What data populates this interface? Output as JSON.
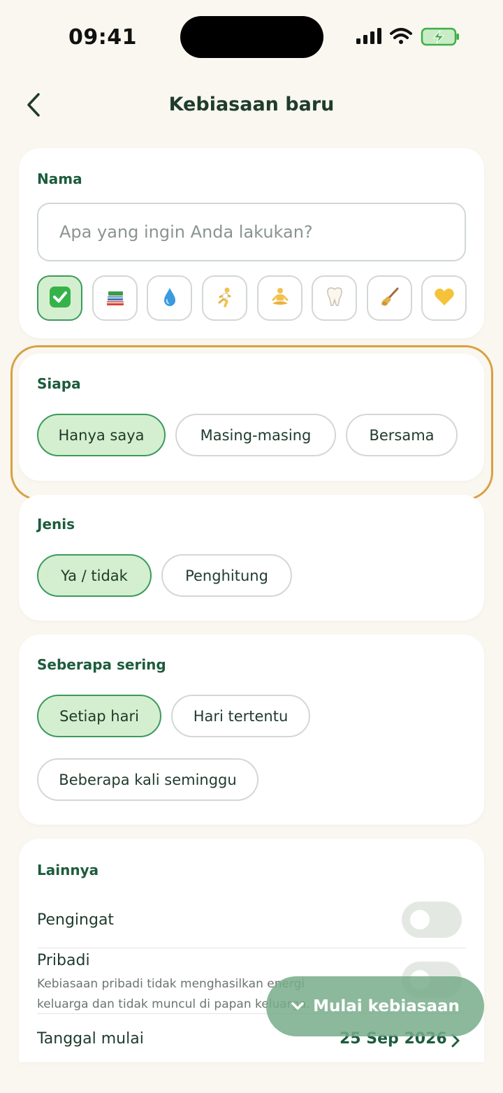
{
  "status_bar": {
    "time": "09:41"
  },
  "header": {
    "title": "Kebiasaan baru",
    "back_icon": "chevron-left-icon"
  },
  "name_section": {
    "label": "Nama",
    "placeholder": "Apa yang ingin Anda lakukan?",
    "value": "",
    "icons": [
      {
        "name": "checkmark-icon",
        "glyph": "✅",
        "selected": true
      },
      {
        "name": "books-icon",
        "glyph": "📚",
        "selected": false
      },
      {
        "name": "droplet-icon",
        "glyph": "💧",
        "selected": false
      },
      {
        "name": "runner-icon",
        "glyph": "🏃",
        "selected": false
      },
      {
        "name": "meditation-icon",
        "glyph": "🧘",
        "selected": false
      },
      {
        "name": "tooth-icon",
        "glyph": "🦷",
        "selected": false
      },
      {
        "name": "broom-icon",
        "glyph": "🧹",
        "selected": false
      },
      {
        "name": "heart-icon",
        "glyph": "💛",
        "selected": false
      }
    ]
  },
  "who_section": {
    "label": "Siapa",
    "options": [
      {
        "label": "Hanya saya",
        "selected": true
      },
      {
        "label": "Masing-masing",
        "selected": false
      },
      {
        "label": "Bersama",
        "selected": false
      }
    ]
  },
  "type_section": {
    "label": "Jenis",
    "options": [
      {
        "label": "Ya / tidak",
        "selected": true
      },
      {
        "label": "Penghitung",
        "selected": false
      }
    ]
  },
  "frequency_section": {
    "label": "Seberapa sering",
    "options": [
      {
        "label": "Setiap hari",
        "selected": true
      },
      {
        "label": "Hari tertentu",
        "selected": false
      },
      {
        "label": "Beberapa kali seminggu",
        "selected": false
      }
    ]
  },
  "other_section": {
    "label": "Lainnya",
    "reminder": {
      "label": "Pengingat",
      "on": false
    },
    "private": {
      "label": "Pribadi",
      "description": "Kebiasaan pribadi tidak menghasilkan energi keluarga dan tidak muncul di papan keluarga.",
      "on": false
    },
    "start_date": {
      "label": "Tanggal mulai",
      "value": "25 Sep 2026"
    }
  },
  "fab": {
    "label": "Mulai kebiasaan",
    "icon": "chevron-down-icon"
  },
  "colors": {
    "background": "#f9f7ef",
    "accent": "#1c5c3c",
    "selected_fill": "#d4efcf",
    "selected_border": "#3c9a5d",
    "highlight": "#d9a043",
    "fab": "#78ac8a"
  }
}
